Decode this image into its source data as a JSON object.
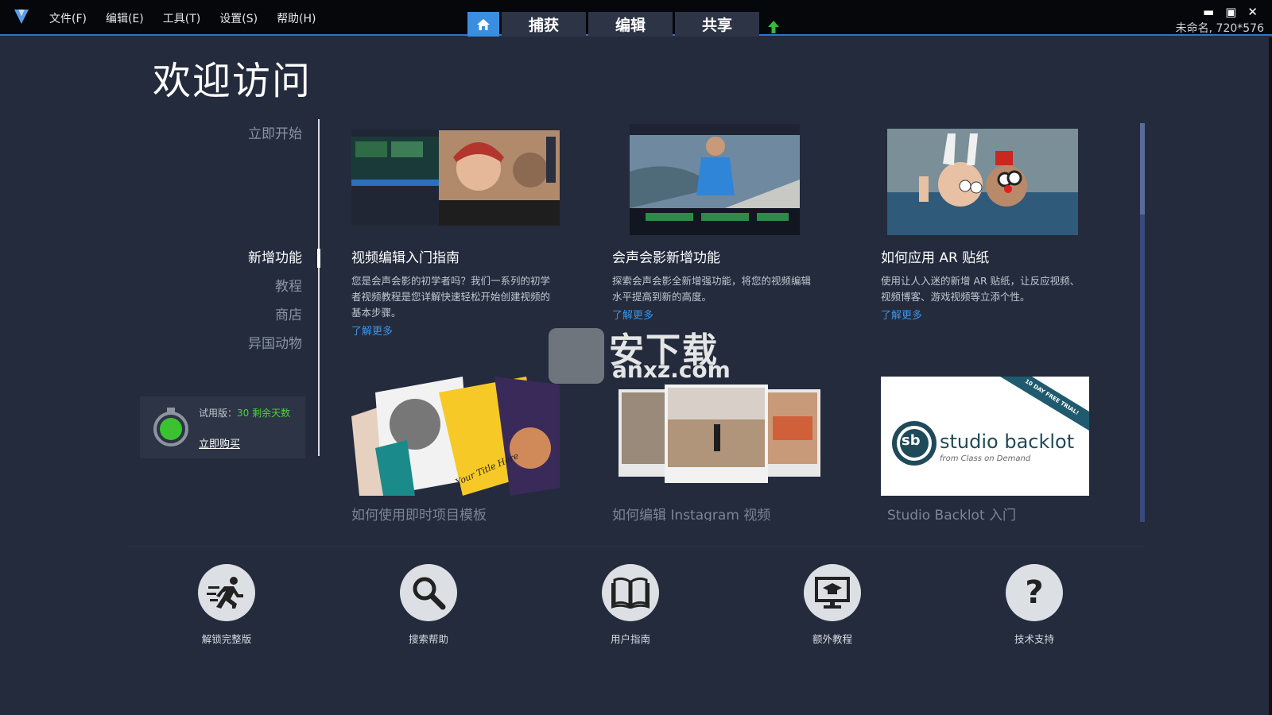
{
  "menu": {
    "items": [
      "文件(F)",
      "编辑(E)",
      "工具(T)",
      "设置(S)",
      "帮助(H)"
    ]
  },
  "navtabs": {
    "home_icon": "home-icon",
    "capture": "捕获",
    "edit": "编辑",
    "share": "共享",
    "upload_icon": "arrow-up-icon"
  },
  "window": {
    "project_info": "未命名, 720*576",
    "controls": [
      "minimize",
      "maximize",
      "close"
    ]
  },
  "page": {
    "title": "欢迎访问"
  },
  "leftnav": {
    "items": [
      "立即开始",
      "新增功能",
      "教程",
      "商店",
      "异国动物"
    ],
    "active": "新增功能"
  },
  "trial": {
    "label": "试用版：",
    "days": "30 剩余天数",
    "buy": "立即购买"
  },
  "cards": [
    {
      "title": "视频编辑入门指南",
      "desc": "您是会声会影的初学者吗？我们一系列的初学者视频教程是您详解快速轻松开始创建视频的基本步骤。",
      "link": "了解更多"
    },
    {
      "title": "会声会影新增功能",
      "desc": "探索会声会影全新增强功能，将您的视频编辑水平提高到新的高度。",
      "link": "了解更多"
    },
    {
      "title": "如何应用 AR 贴纸",
      "desc": "使用让人入迷的新增 AR 贴纸，让反应视频、视频博客、游戏视频等立添个性。",
      "link": "了解更多"
    }
  ],
  "cards_row2": [
    {
      "title": "如何使用即时项目模板",
      "thumb_text": "Your Title Here"
    },
    {
      "title": "如何编辑 Instagram 视频"
    },
    {
      "title": "Studio Backlot 入门",
      "logo_text": "studio backlot",
      "logo_sub": "from Class on Demand",
      "ribbon": "10 DAY FREE TRIAL!"
    }
  ],
  "bottom": [
    {
      "label": "解锁完整版",
      "icon": "running-man-icon"
    },
    {
      "label": "搜索帮助",
      "icon": "search-icon"
    },
    {
      "label": "用户指南",
      "icon": "book-icon"
    },
    {
      "label": "额外教程",
      "icon": "monitor-graduation-icon"
    },
    {
      "label": "技术支持",
      "icon": "question-icon"
    }
  ],
  "watermark": {
    "text": "安下载",
    "sub": "anxz.com"
  },
  "colors": {
    "background": "#232b3d",
    "topbar": "#05070a",
    "accent": "#3a8ee0",
    "link": "#3c94e6",
    "trial_green": "#4cd13b"
  }
}
